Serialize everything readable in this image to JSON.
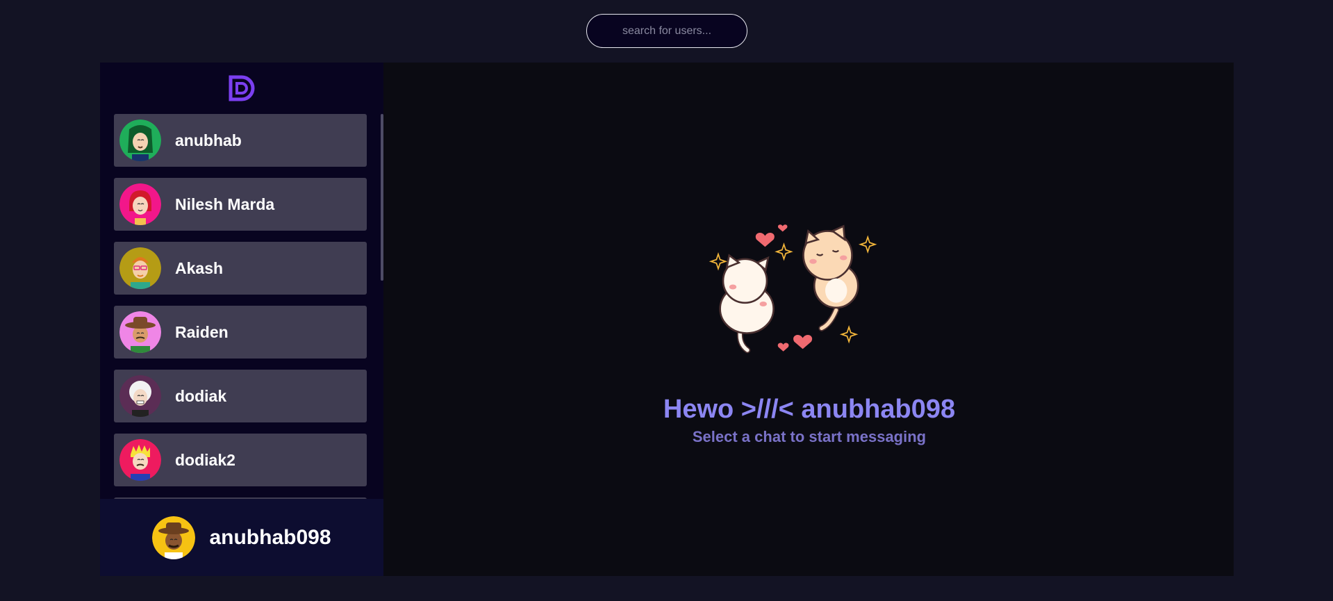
{
  "search": {
    "placeholder": "search for users..."
  },
  "sidebar": {
    "brand_icon": "app-logo-icon",
    "contacts": [
      {
        "name": "anubhab",
        "avatar_bg": "#1fae5a"
      },
      {
        "name": "Nilesh Marda",
        "avatar_bg": "#f2178a"
      },
      {
        "name": "Akash",
        "avatar_bg": "#b59c15"
      },
      {
        "name": "Raiden",
        "avatar_bg": "#ef86e6"
      },
      {
        "name": "dodiak",
        "avatar_bg": "#5b2d55"
      },
      {
        "name": "dodiak2",
        "avatar_bg": "#ee1b5f"
      }
    ],
    "current_user": {
      "name": "anubhab098",
      "avatar_bg": "#f6c213"
    }
  },
  "welcome": {
    "title": "Hewo >///< anubhab098",
    "subtitle": "Select a chat to start messaging"
  },
  "colors": {
    "accent": "#8c86f2",
    "card": "#403d52",
    "sidebar": "#080420",
    "page": "#131324"
  }
}
